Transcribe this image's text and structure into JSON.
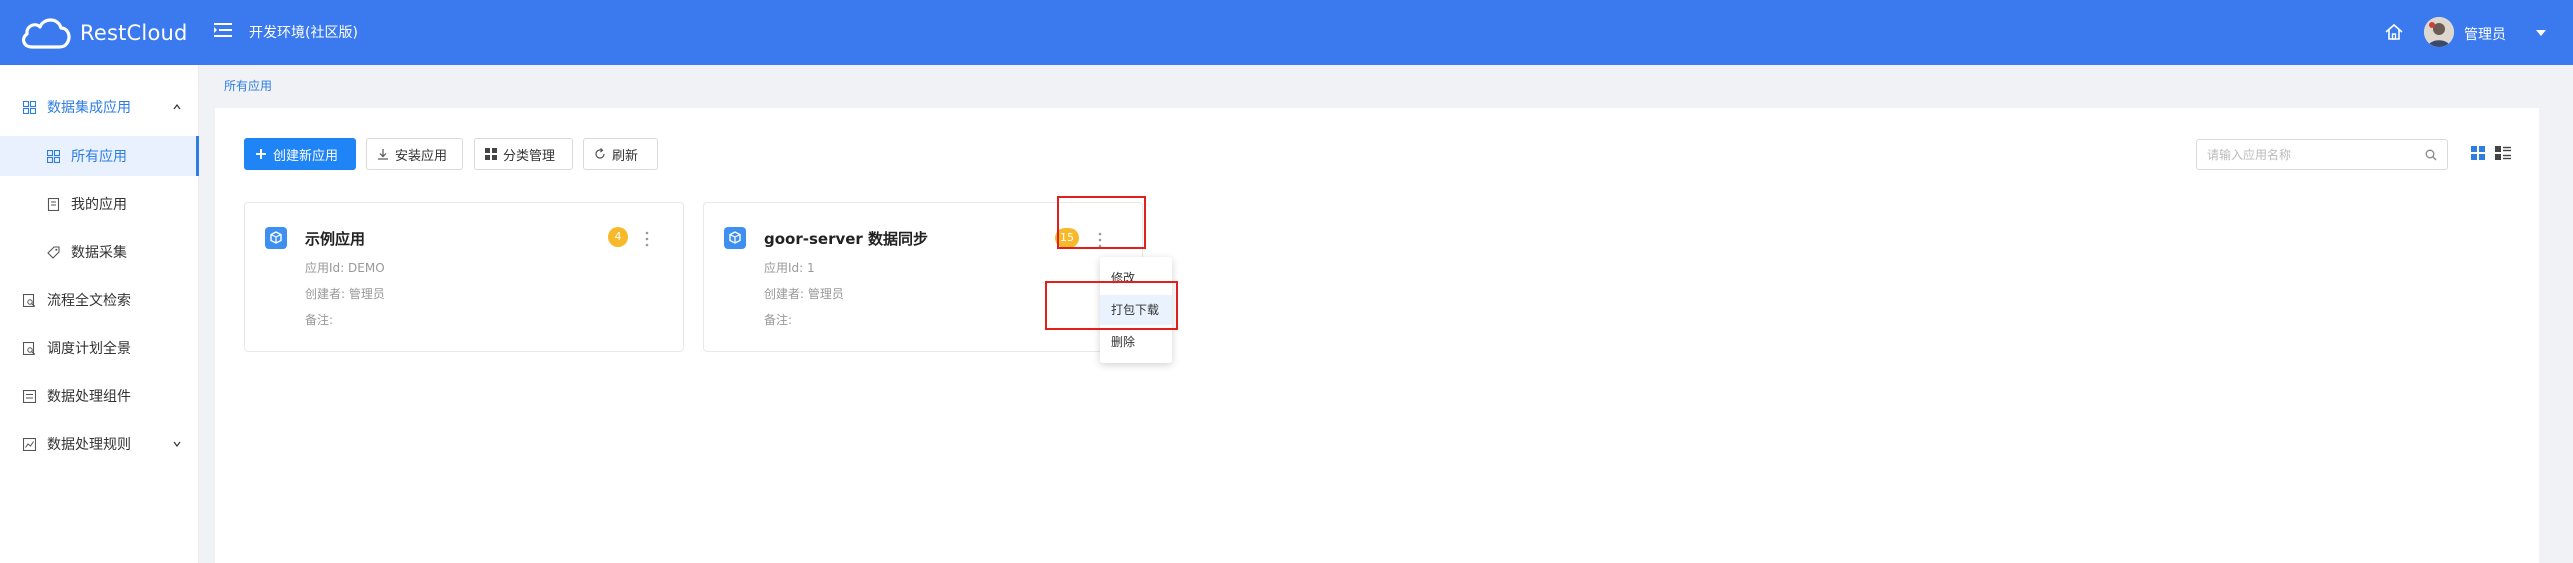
{
  "header": {
    "logo_text": "RestCloud",
    "env_title": "开发环境(社区版)",
    "user_name": "管理员",
    "color": "#3a7aee"
  },
  "sidebar": {
    "groups": [
      {
        "label": "数据集成应用",
        "icon": "grid-icon",
        "expanded": true
      },
      {
        "label": "流程全文检索",
        "icon": "document-search-icon"
      },
      {
        "label": "调度计划全景",
        "icon": "document-search-icon"
      },
      {
        "label": "数据处理组件",
        "icon": "list-box-icon"
      },
      {
        "label": "数据处理规则",
        "icon": "chart-box-icon",
        "collapsible": true
      }
    ],
    "sub_items": [
      {
        "label": "所有应用",
        "icon": "grid-icon",
        "active": true
      },
      {
        "label": "我的应用",
        "icon": "document-icon"
      },
      {
        "label": "数据采集",
        "icon": "tag-icon"
      }
    ]
  },
  "breadcrumb": "所有应用",
  "toolbar": {
    "create_label": "创建新应用",
    "install_label": "安装应用",
    "category_label": "分类管理",
    "refresh_label": "刷新",
    "search_placeholder": "请输入应用名称"
  },
  "cards": [
    {
      "title": "示例应用",
      "count": "4",
      "app_id": "应用Id: DEMO",
      "creator": "创建者: 管理员",
      "note": "备注:"
    },
    {
      "title": "goor-server 数据同步",
      "count": "15",
      "app_id": "应用Id: 1",
      "creator": "创建者: 管理员",
      "note": "备注:"
    }
  ],
  "dropdown": {
    "items": [
      "修改",
      "打包下载",
      "删除"
    ],
    "highlighted": "打包下载"
  },
  "colors": {
    "accent": "#2f7de1",
    "primary_button": "#1f84f5",
    "badge": "#f7b92a",
    "annotation": "#e0201c"
  }
}
